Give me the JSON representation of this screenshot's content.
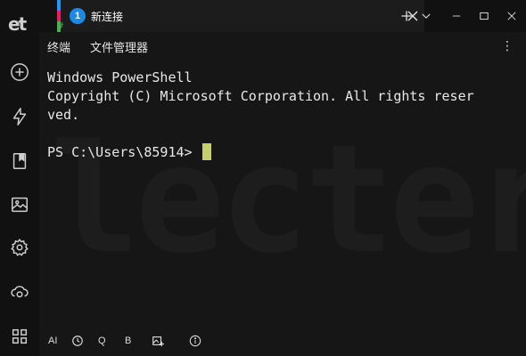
{
  "app": {
    "logo": "et"
  },
  "tab": {
    "number": "1",
    "title": "新连接",
    "hash": "#"
  },
  "subtabs": [
    {
      "label": "终端"
    },
    {
      "label": "文件管理器"
    }
  ],
  "terminal": {
    "lines": [
      "Windows PowerShell",
      "Copyright (C) Microsoft Corporation. All rights reser",
      "ved.",
      "",
      "PS C:\\Users\\85914> "
    ],
    "watermark": "lecteri",
    "cursor_color": "#c6d06a"
  },
  "bottombar": {
    "ai_label": "AI",
    "q_label": "Q",
    "b_label": "B"
  },
  "colors": {
    "accent": "#1e88e5",
    "active_underline": "#4a90d9"
  },
  "icons": [
    "add-circle-icon",
    "lightning-icon",
    "bookmark-icon",
    "image-icon",
    "gear-icon",
    "cloud-sync-icon",
    "grid-icon",
    "close-icon",
    "plus-icon",
    "chevron-down-icon",
    "minimize-icon",
    "maximize-icon",
    "history-icon",
    "image-plus-icon",
    "info-icon",
    "more-vertical-icon"
  ]
}
